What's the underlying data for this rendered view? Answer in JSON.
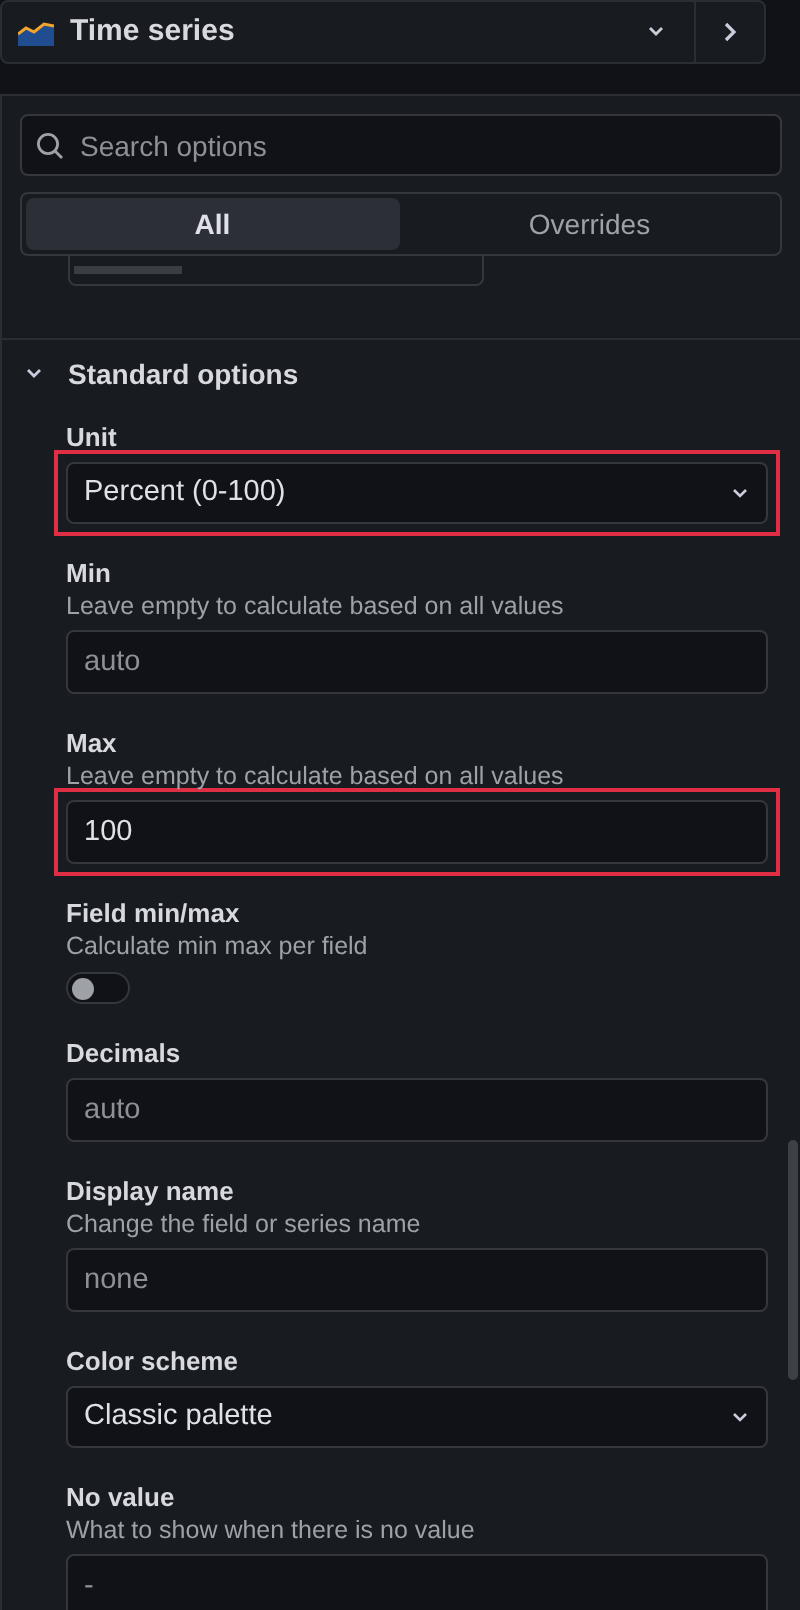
{
  "header": {
    "title": "Time series"
  },
  "search": {
    "placeholder": "Search options"
  },
  "tabs": [
    {
      "label": "All",
      "selected": true
    },
    {
      "label": "Overrides",
      "selected": false
    }
  ],
  "section": {
    "title": "Standard options",
    "expanded": true
  },
  "fields": [
    {
      "kind": "select",
      "label": "Unit",
      "value": "Percent (0-100)",
      "highlighted": true
    },
    {
      "kind": "input",
      "label": "Min",
      "description": "Leave empty to calculate based on all values",
      "placeholder": "auto",
      "highlighted": false
    },
    {
      "kind": "input",
      "label": "Max",
      "description": "Leave empty to calculate based on all values",
      "value": "100",
      "highlighted": true
    },
    {
      "kind": "toggle",
      "label": "Field min/max",
      "description": "Calculate min max per field",
      "on": false
    },
    {
      "kind": "input",
      "label": "Decimals",
      "placeholder": "auto",
      "highlighted": false
    },
    {
      "kind": "input",
      "label": "Display name",
      "description": "Change the field or series name",
      "placeholder": "none",
      "highlighted": false
    },
    {
      "kind": "select",
      "label": "Color scheme",
      "value": "Classic palette",
      "highlighted": false
    },
    {
      "kind": "input",
      "label": "No value",
      "description": "What to show when there is no value",
      "placeholder": "-",
      "highlighted": false
    }
  ]
}
